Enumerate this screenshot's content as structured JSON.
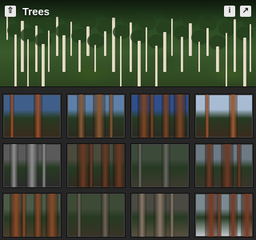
{
  "header": {
    "title": "Trees",
    "back_icon": "arrow-up-icon",
    "info_icon": "info-icon",
    "share_icon": "share-icon"
  },
  "gallery": {
    "tiles": [
      {
        "name": "giant-sequoia-canopy",
        "sky": "#3f5f8a",
        "ground": "#3a2a1d",
        "trunk": "#a0502a"
      },
      {
        "name": "redwood-trunks-sky",
        "sky": "#5e80a8",
        "ground": "#2b2a20",
        "trunk": "#8a5a35"
      },
      {
        "name": "sequoia-grove-blue-sky",
        "sky": "#2f4f8d",
        "ground": "#2a2a24",
        "trunk": "#7d4526"
      },
      {
        "name": "leaning-giant-sequoia",
        "sky": "#a7bcd2",
        "ground": "#3b2a1e",
        "trunk": "#a05a30"
      },
      {
        "name": "fallen-sequoia-bw",
        "sky": "#5a5a5a",
        "ground": "#2b2b2b",
        "trunk": "#8f8f8f"
      },
      {
        "name": "redwood-forest-path",
        "sky": "#4b4a3c",
        "ground": "#2f2a22",
        "trunk": "#6b3a22"
      },
      {
        "name": "sequoia-stump-clearing",
        "sky": "#3c4a3a",
        "ground": "#3e3b2f",
        "trunk": "#6a6a62"
      },
      {
        "name": "misty-redwood-grove",
        "sky": "#6d7a84",
        "ground": "#3a342a",
        "trunk": "#6e3a25"
      },
      {
        "name": "sequoia-base-trunk",
        "sky": "#4c5a46",
        "ground": "#4b3d2a",
        "trunk": "#8b4a28"
      },
      {
        "name": "hollow-giant-trunk",
        "sky": "#3d4a35",
        "ground": "#3a3326",
        "trunk": "#706458"
      },
      {
        "name": "tunnel-tree",
        "sky": "#4a4a42",
        "ground": "#5a5040",
        "trunk": "#8a7a68"
      },
      {
        "name": "sequoias-in-snow",
        "sky": "#7a8a90",
        "ground": "#c8cdd2",
        "trunk": "#7b3a22"
      }
    ]
  }
}
